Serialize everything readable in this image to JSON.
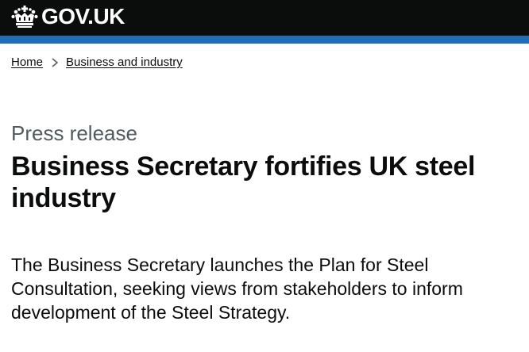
{
  "header": {
    "logo_text": "GOV.UK",
    "logo_icon": "crown-icon",
    "stripe_color": "#1d70b8"
  },
  "breadcrumb": {
    "items": [
      {
        "label": "Home"
      },
      {
        "label": "Business and industry"
      }
    ],
    "separator_icon": "chevron-right-icon"
  },
  "main": {
    "caption": "Press release",
    "title": "Business Secretary fortifies UK steel industry",
    "lead": "The Business Secretary launches the Plan for Steel Consultation, seeking views from stakeholders to inform development of the Steel Strategy."
  }
}
